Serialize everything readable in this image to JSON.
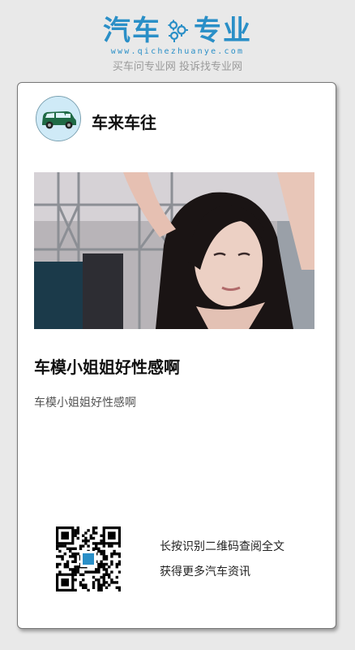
{
  "brand": {
    "name_left": "汽车",
    "name_right": "专业",
    "url": "www.qichezhuanye.com",
    "slogan": "买车问专业网 投诉找专业网"
  },
  "colors": {
    "brand": "#2a8fc7",
    "card": "#ffffff",
    "background": "#e9e9e9"
  },
  "card": {
    "author": "车来车往",
    "avatar_icon": "green-car-icon",
    "title": "车模小姐姐好性感啊",
    "description": "车模小姐姐好性感啊",
    "qr_line1": "长按识别二维码查阅全文",
    "qr_line2": "获得更多汽车资讯",
    "qr_icon": "qr-code-icon"
  }
}
